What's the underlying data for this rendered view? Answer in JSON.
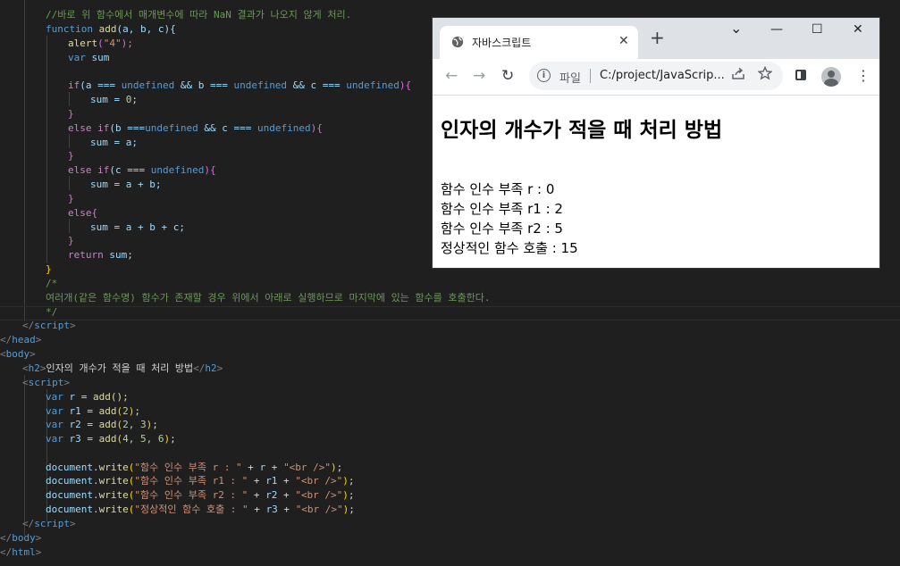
{
  "editor": {
    "code": {
      "comment_nan": "//바로 위 함수에서 매개변수에 따라 NaN 결과가 나오지 않게 처리.",
      "func_kw": "function",
      "func_name": "add",
      "func_params": "(a, b, c){",
      "alert_fn": "alert",
      "alert_arg": "\"4\"",
      "var_kw": "var",
      "sum_name": "sum",
      "if1_a": "(a === ",
      "undefined": "undefined",
      "if1_mid_b": " && b === ",
      "if1_mid_c": " && c === ",
      "if1_end": "){",
      "sum_zero": "sum = ",
      "zero": "0",
      "else_kw": "else",
      "if_kw": "if",
      "if2_b": "(b ===",
      "sum_a": "sum = a;",
      "if3_c": "(c === ",
      "sum_ab": "sum = a + b;",
      "else_brace": "{",
      "sum_abc": "sum = a + b + c;",
      "return_kw": "return",
      "return_val": " sum;",
      "block_comment_open": "/*",
      "block_comment_body": "여러개(같은 함수명) 함수가 존재할 경우 위에서 아래로 실행하므로 마지막에 있는 함수를 호출한다.",
      "block_comment_close": "*/",
      "script_close": "script",
      "head_close": "head",
      "body_open": "body",
      "h2_tag": "h2",
      "h2_text": "인자의 개수가 적을 때 처리 방법",
      "script_open": "script",
      "var_r": "r",
      "var_r1": "r1",
      "var_r2": "r2",
      "var_r3": "r3",
      "call_r": "add();",
      "call_r1_args": "2",
      "call_r2_args": "2, 3",
      "call_r3_args": "4, 5, 6",
      "doc": "document",
      "write": "write",
      "w1_str": "\"함수 인수 부족 r : \"",
      "w2_str": "\"함수 인수 부족 r1 : \"",
      "w3_str": "\"함수 인수 부족 r2 : \"",
      "w4_str": "\"정상적인 함수 호출 : \"",
      "br_str": "\"<br />\"",
      "body_close": "body",
      "html_close": "html"
    }
  },
  "browser": {
    "tab_title": "자바스크립트",
    "tab_close": "✕",
    "new_tab": "+",
    "win_minimize": "—",
    "win_maximize": "☐",
    "win_close": "✕",
    "win_dropdown": "⌄",
    "nav_back": "←",
    "nav_forward": "→",
    "nav_reload": "↻",
    "omni_info": "i",
    "omni_scheme": "파일",
    "omni_url": "C:/project/JavaScrip...",
    "menu": "⋮"
  },
  "page": {
    "heading": "인자의 개수가 적을 때 처리 방법",
    "lines": [
      "함수 인수 부족 r : 0",
      "함수 인수 부족 r1 : 2",
      "함수 인수 부족 r2 : 5",
      "정상적인 함수 호출 : 15"
    ]
  }
}
